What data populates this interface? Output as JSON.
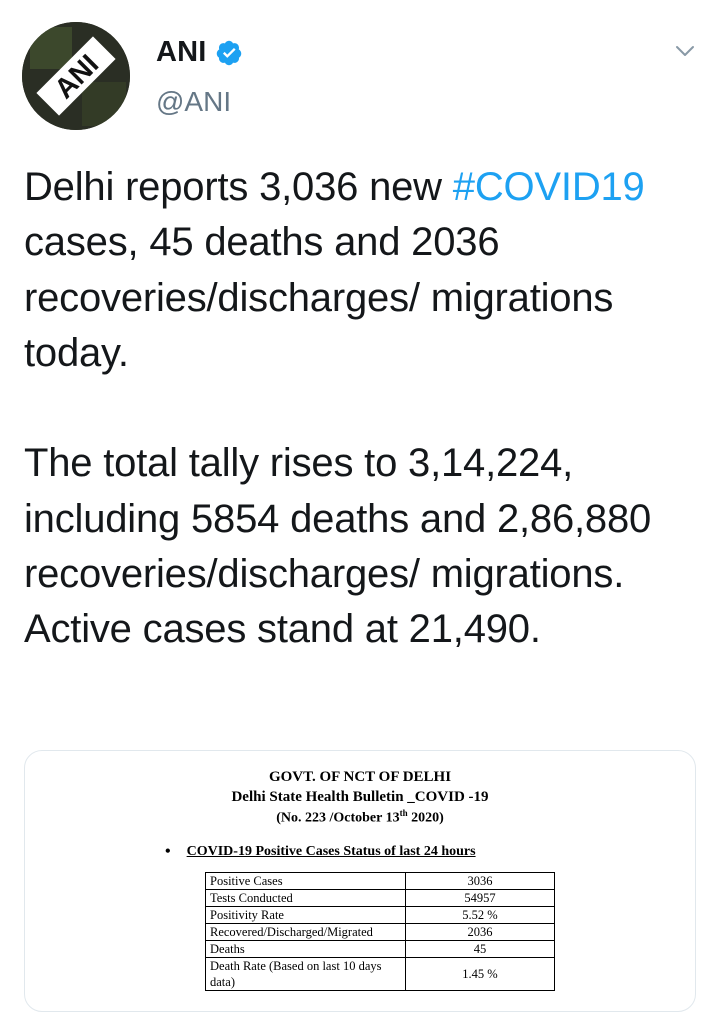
{
  "author": {
    "display_name": "ANI",
    "handle": "@ANI",
    "avatar_text": "ANI"
  },
  "tweet": {
    "part1": "Delhi reports 3,036 new ",
    "hashtag": "#COVID19",
    "part2": " cases, 45 deaths and 2036 recoveries/discharges/ migrations today.\n\nThe total tally rises to 3,14,224, including 5854 deaths and 2,86,880 recoveries/discharges/ migrations. Active cases stand at 21,490."
  },
  "bulletin": {
    "title": "GOVT. OF NCT OF DELHI",
    "subtitle": "Delhi State Health Bulletin _COVID -19",
    "number_prefix": "(No. 223 /October 13",
    "number_sup": "th",
    "number_suffix": " 2020)",
    "section_heading": "COVID-19 Positive Cases Status of last 24 hours",
    "rows": [
      {
        "label": "Positive Cases",
        "value": "3036"
      },
      {
        "label": "Tests Conducted",
        "value": "54957"
      },
      {
        "label": "Positivity Rate",
        "value": "5.52 %"
      },
      {
        "label": "Recovered/Discharged/Migrated",
        "value": "2036"
      },
      {
        "label": "Deaths",
        "value": "45"
      },
      {
        "label": "Death Rate (Based on last 10 days data)",
        "value": "1.45 %"
      }
    ]
  },
  "icons": {
    "verified": "verified-badge-icon",
    "menu": "chevron-down-icon"
  },
  "colors": {
    "link": "#1da1f2",
    "secondary_text": "#657786",
    "primary_text": "#14171a"
  }
}
